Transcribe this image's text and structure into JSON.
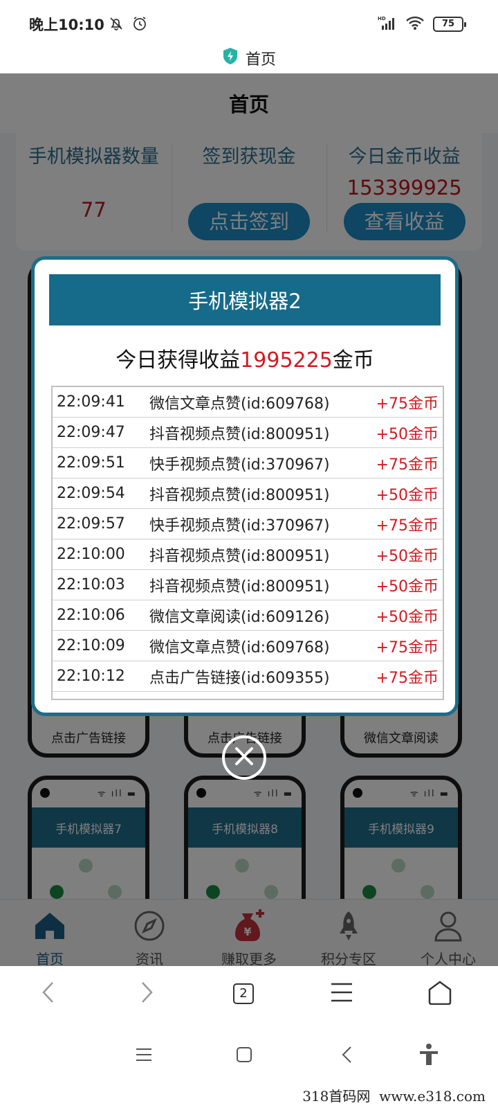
{
  "status_bar": {
    "time": "晚上10:10",
    "battery": "75"
  },
  "browser": {
    "tab_title": "首页",
    "tab_count": "2"
  },
  "app": {
    "header_title": "首页",
    "stats": [
      {
        "title": "手机模拟器数量",
        "value": "77"
      },
      {
        "title": "签到获现金",
        "button": "点击签到"
      },
      {
        "title": "今日金币收益",
        "value": "153399925",
        "button": "查看收益"
      }
    ],
    "phones": [
      {
        "caption": "点击广告链接"
      },
      {
        "caption": "点击广告链接"
      },
      {
        "caption": "微信文章阅读"
      },
      {
        "name": "手机模拟器7"
      },
      {
        "name": "手机模拟器8"
      },
      {
        "name": "手机模拟器9"
      }
    ]
  },
  "modal": {
    "title": "手机模拟器2",
    "income_prefix": "今日获得收益",
    "income_value": "1995225",
    "income_suffix": "金币",
    "log": [
      {
        "time": "22:09:41",
        "action": "微信文章点赞(id:609768)",
        "reward": "+75金币"
      },
      {
        "time": "22:09:47",
        "action": "抖音视频点赞(id:800951)",
        "reward": "+50金币"
      },
      {
        "time": "22:09:51",
        "action": "快手视频点赞(id:370967)",
        "reward": "+75金币"
      },
      {
        "time": "22:09:54",
        "action": "抖音视频点赞(id:800951)",
        "reward": "+50金币"
      },
      {
        "time": "22:09:57",
        "action": "快手视频点赞(id:370967)",
        "reward": "+75金币"
      },
      {
        "time": "22:10:00",
        "action": "抖音视频点赞(id:800951)",
        "reward": "+50金币"
      },
      {
        "time": "22:10:03",
        "action": "抖音视频点赞(id:800951)",
        "reward": "+50金币"
      },
      {
        "time": "22:10:06",
        "action": "微信文章阅读(id:609126)",
        "reward": "+50金币"
      },
      {
        "time": "22:10:09",
        "action": "微信文章点赞(id:609768)",
        "reward": "+75金币"
      },
      {
        "time": "22:10:12",
        "action": "点击广告链接(id:609355)",
        "reward": "+75金币"
      }
    ]
  },
  "bottom_nav": [
    {
      "label": "首页",
      "icon": "home-icon"
    },
    {
      "label": "资讯",
      "icon": "compass-icon"
    },
    {
      "label": "赚取更多",
      "icon": "money-bag-icon"
    },
    {
      "label": "积分专区",
      "icon": "rocket-icon"
    },
    {
      "label": "个人中心",
      "icon": "person-icon"
    }
  ],
  "watermark": "318首码网  www.e318.com",
  "colors": {
    "brand_teal": "#166a8a",
    "accent_blue": "#1d8cc6",
    "value_red": "#d11b22"
  }
}
